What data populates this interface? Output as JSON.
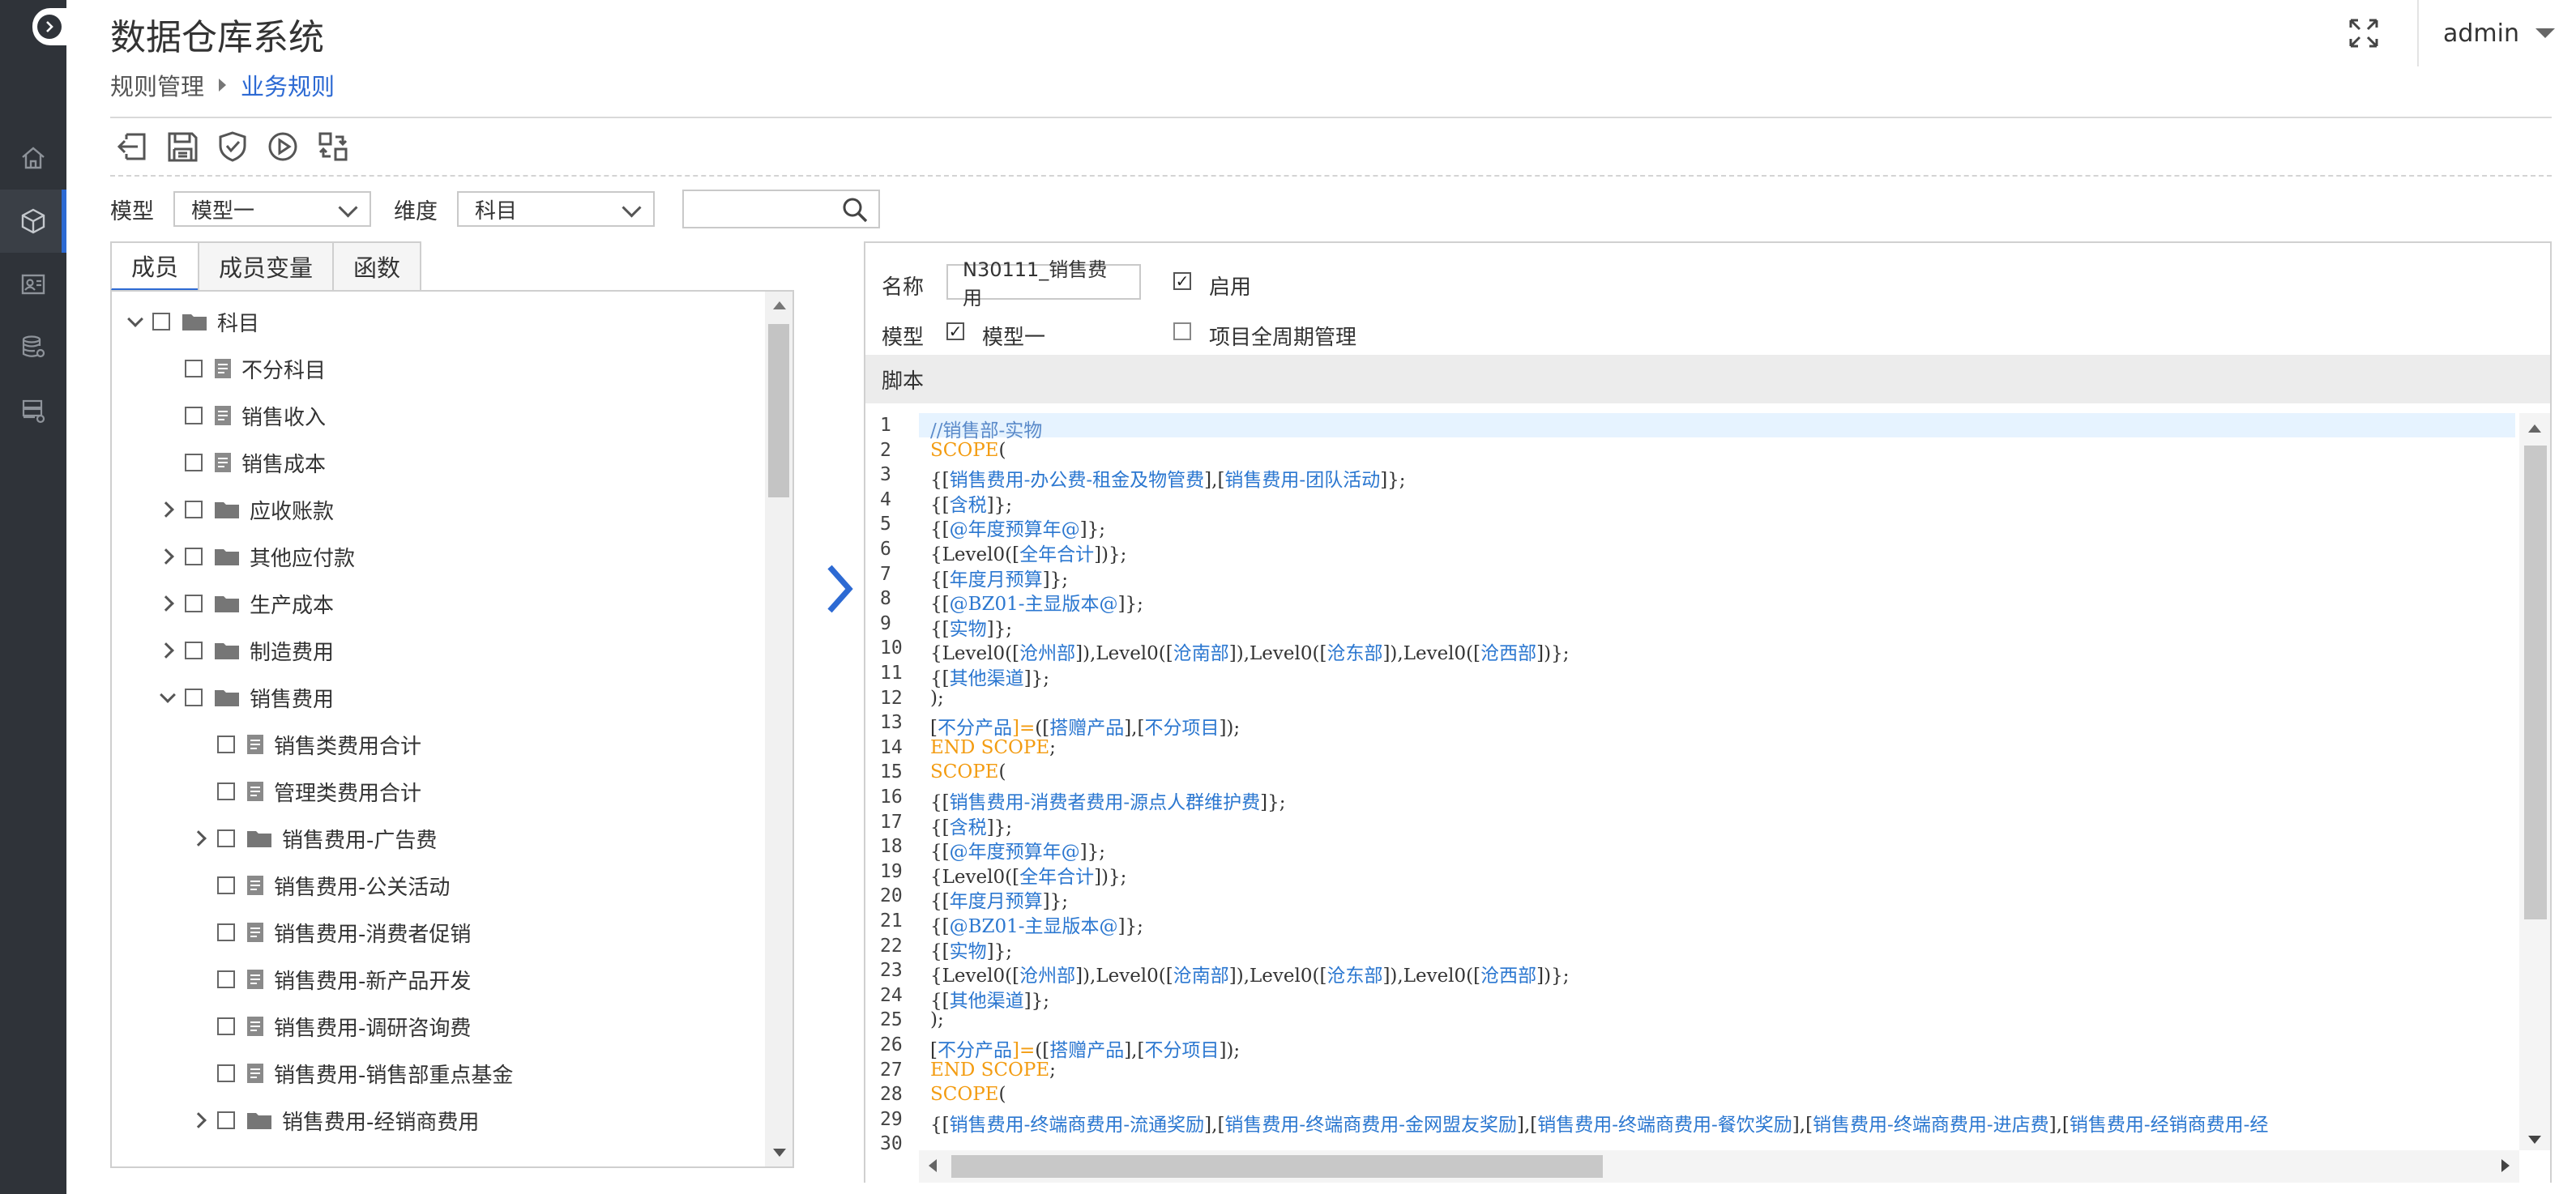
{
  "app": {
    "title": "数据仓库系统",
    "user": "admin"
  },
  "breadcrumb": {
    "parent": "规则管理",
    "current": "业务规则"
  },
  "sidebar": {
    "items": [
      {
        "icon": "home-icon"
      },
      {
        "icon": "cube-icon",
        "active": true
      },
      {
        "icon": "id-card-icon"
      },
      {
        "icon": "database-settings-icon"
      },
      {
        "icon": "server-settings-icon"
      }
    ]
  },
  "toolbar": {
    "buttons": [
      {
        "icon": "exit-icon"
      },
      {
        "icon": "save-icon"
      },
      {
        "icon": "shield-check-icon"
      },
      {
        "icon": "play-icon"
      },
      {
        "icon": "transfer-icon"
      }
    ]
  },
  "filters": {
    "model_label": "模型",
    "model_value": "模型一",
    "dimension_label": "维度",
    "dimension_value": "科目",
    "search_value": ""
  },
  "tabs": [
    {
      "label": "成员",
      "active": true
    },
    {
      "label": "成员变量",
      "active": false
    },
    {
      "label": "函数",
      "active": false
    }
  ],
  "tree": [
    {
      "label": "科目",
      "level": 0,
      "type": "folder",
      "expand": "open"
    },
    {
      "label": "不分科目",
      "level": 1,
      "type": "file",
      "expand": "none"
    },
    {
      "label": "销售收入",
      "level": 1,
      "type": "file",
      "expand": "none"
    },
    {
      "label": "销售成本",
      "level": 1,
      "type": "file",
      "expand": "none"
    },
    {
      "label": "应收账款",
      "level": 1,
      "type": "folder",
      "expand": "closed"
    },
    {
      "label": "其他应付款",
      "level": 1,
      "type": "folder",
      "expand": "closed"
    },
    {
      "label": "生产成本",
      "level": 1,
      "type": "folder",
      "expand": "closed"
    },
    {
      "label": "制造费用",
      "level": 1,
      "type": "folder",
      "expand": "closed"
    },
    {
      "label": "销售费用",
      "level": 1,
      "type": "folder",
      "expand": "open"
    },
    {
      "label": "销售类费用合计",
      "level": 2,
      "type": "file",
      "expand": "none"
    },
    {
      "label": "管理类费用合计",
      "level": 2,
      "type": "file",
      "expand": "none"
    },
    {
      "label": "销售费用-广告费",
      "level": 2,
      "type": "folder",
      "expand": "closed"
    },
    {
      "label": "销售费用-公关活动",
      "level": 2,
      "type": "file",
      "expand": "none"
    },
    {
      "label": "销售费用-消费者促销",
      "level": 2,
      "type": "file",
      "expand": "none"
    },
    {
      "label": "销售费用-新产品开发",
      "level": 2,
      "type": "file",
      "expand": "none"
    },
    {
      "label": "销售费用-调研咨询费",
      "level": 2,
      "type": "file",
      "expand": "none"
    },
    {
      "label": "销售费用-销售部重点基金",
      "level": 2,
      "type": "file",
      "expand": "none"
    },
    {
      "label": "销售费用-经销商费用",
      "level": 2,
      "type": "folder",
      "expand": "closed"
    }
  ],
  "rule": {
    "name_label": "名称",
    "name_value": "N30111_销售费用",
    "enabled_label": "启用",
    "enabled": true,
    "model_label": "模型",
    "model_option": "模型一",
    "model_checked": true,
    "full_cycle_label": "项目全周期管理",
    "full_cycle_checked": false,
    "script_label": "脚本"
  },
  "script_lines": [
    [
      [
        "c",
        "//销售部-实物"
      ]
    ],
    [
      [
        "k",
        "SCOPE"
      ],
      [
        "t",
        "("
      ]
    ],
    [
      [
        "t",
        "{["
      ],
      [
        "m",
        "销售费用-办公费-租金及物管费"
      ],
      [
        "t",
        "],["
      ],
      [
        "m",
        "销售费用-团队活动"
      ],
      [
        "t",
        "]};"
      ]
    ],
    [
      [
        "t",
        "{["
      ],
      [
        "m",
        "含税"
      ],
      [
        "t",
        "]};"
      ]
    ],
    [
      [
        "t",
        "{["
      ],
      [
        "m",
        "@年度预算年@"
      ],
      [
        "t",
        "]};"
      ]
    ],
    [
      [
        "t",
        "{Level0(["
      ],
      [
        "m",
        "全年合计"
      ],
      [
        "t",
        "])};"
      ]
    ],
    [
      [
        "t",
        "{["
      ],
      [
        "m",
        "年度月预算"
      ],
      [
        "t",
        "]};"
      ]
    ],
    [
      [
        "t",
        "{["
      ],
      [
        "m",
        "@BZ01-主显版本@"
      ],
      [
        "t",
        "]};"
      ]
    ],
    [
      [
        "t",
        "{["
      ],
      [
        "m",
        "实物"
      ],
      [
        "t",
        "]};"
      ]
    ],
    [
      [
        "t",
        "{Level0(["
      ],
      [
        "m",
        "沧州部"
      ],
      [
        "t",
        "]),Level0(["
      ],
      [
        "m",
        "沧南部"
      ],
      [
        "t",
        "]),Level0(["
      ],
      [
        "m",
        "沧东部"
      ],
      [
        "t",
        "]),Level0(["
      ],
      [
        "m",
        "沧西部"
      ],
      [
        "t",
        "])};"
      ]
    ],
    [
      [
        "t",
        "{["
      ],
      [
        "m",
        "其他渠道"
      ],
      [
        "t",
        "]};"
      ]
    ],
    [
      [
        "t",
        ");"
      ]
    ],
    [
      [
        "t",
        "["
      ],
      [
        "m",
        "不分产品"
      ],
      [
        "k",
        "]="
      ],
      [
        "t",
        "(["
      ],
      [
        "m",
        "搭赠产品"
      ],
      [
        "t",
        "],["
      ],
      [
        "m",
        "不分项目"
      ],
      [
        "t",
        "]);"
      ]
    ],
    [
      [
        "k",
        "END SCOPE"
      ],
      [
        "t",
        ";"
      ]
    ],
    [
      [
        "k",
        "SCOPE"
      ],
      [
        "t",
        "("
      ]
    ],
    [
      [
        "t",
        "{["
      ],
      [
        "m",
        "销售费用-消费者费用-源点人群维护费"
      ],
      [
        "t",
        "]};"
      ]
    ],
    [
      [
        "t",
        "{["
      ],
      [
        "m",
        "含税"
      ],
      [
        "t",
        "]};"
      ]
    ],
    [
      [
        "t",
        "{["
      ],
      [
        "m",
        "@年度预算年@"
      ],
      [
        "t",
        "]};"
      ]
    ],
    [
      [
        "t",
        "{Level0(["
      ],
      [
        "m",
        "全年合计"
      ],
      [
        "t",
        "])};"
      ]
    ],
    [
      [
        "t",
        "{["
      ],
      [
        "m",
        "年度月预算"
      ],
      [
        "t",
        "]};"
      ]
    ],
    [
      [
        "t",
        "{["
      ],
      [
        "m",
        "@BZ01-主显版本@"
      ],
      [
        "t",
        "]};"
      ]
    ],
    [
      [
        "t",
        "{["
      ],
      [
        "m",
        "实物"
      ],
      [
        "t",
        "]};"
      ]
    ],
    [
      [
        "t",
        "{Level0(["
      ],
      [
        "m",
        "沧州部"
      ],
      [
        "t",
        "]),Level0(["
      ],
      [
        "m",
        "沧南部"
      ],
      [
        "t",
        "]),Level0(["
      ],
      [
        "m",
        "沧东部"
      ],
      [
        "t",
        "]),Level0(["
      ],
      [
        "m",
        "沧西部"
      ],
      [
        "t",
        "])};"
      ]
    ],
    [
      [
        "t",
        "{["
      ],
      [
        "m",
        "其他渠道"
      ],
      [
        "t",
        "]};"
      ]
    ],
    [
      [
        "t",
        ");"
      ]
    ],
    [
      [
        "t",
        "["
      ],
      [
        "m",
        "不分产品"
      ],
      [
        "k",
        "]="
      ],
      [
        "t",
        "(["
      ],
      [
        "m",
        "搭赠产品"
      ],
      [
        "t",
        "],["
      ],
      [
        "m",
        "不分项目"
      ],
      [
        "t",
        "]);"
      ]
    ],
    [
      [
        "k",
        "END SCOPE"
      ],
      [
        "t",
        ";"
      ]
    ],
    [
      [
        "k",
        "SCOPE"
      ],
      [
        "t",
        "("
      ]
    ],
    [
      [
        "t",
        "{["
      ],
      [
        "m",
        "销售费用-终端商费用-流通奖励"
      ],
      [
        "t",
        "],["
      ],
      [
        "m",
        "销售费用-终端商费用-金网盟友奖励"
      ],
      [
        "t",
        "],["
      ],
      [
        "m",
        "销售费用-终端商费用-餐饮奖励"
      ],
      [
        "t",
        "],["
      ],
      [
        "m",
        "销售费用-终端商费用-进店费"
      ],
      [
        "t",
        "],["
      ],
      [
        "m",
        "销售费用-经销商费用-经"
      ]
    ],
    []
  ],
  "colors": {
    "accent": "#2d6ad3",
    "rail": "#2f3339",
    "keyword": "#f39c12",
    "member": "#2b77d0",
    "comment": "#5a8ac9",
    "highlight_line": "#e6f3ff"
  }
}
